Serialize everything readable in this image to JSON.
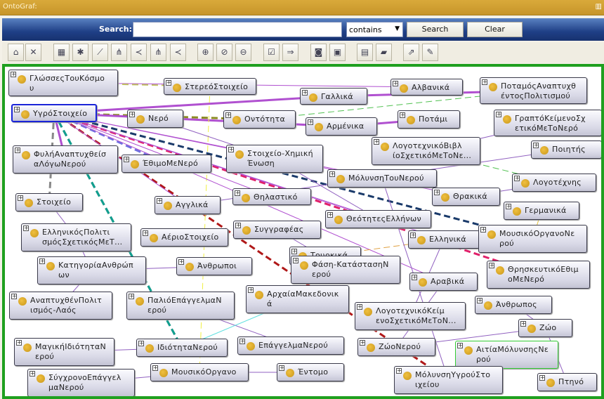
{
  "window": {
    "title": "OntoGraf:"
  },
  "search": {
    "label": "Search:",
    "value": "",
    "placeholder": "",
    "match_mode": "contains",
    "search_button": "Search",
    "clear_button": "Clear"
  },
  "toolbar": {
    "icons": [
      "home-icon",
      "remove-icon",
      "grid-layout-icon",
      "spring-layout-icon",
      "radial-layout-icon",
      "tree-vertical-icon",
      "tree-horizontal-icon",
      "tree-vertical-alt-icon",
      "tree-horizontal-alt-icon",
      "zoom-in-icon",
      "zoom-reset-icon",
      "zoom-out-icon",
      "filter-nodes-icon",
      "filter-arcs-icon",
      "snapshot-icon",
      "export-image-icon",
      "save-icon",
      "open-icon",
      "export-icon",
      "edit-icon"
    ]
  },
  "colors": {
    "accent": "#1fa01f",
    "selected": "#1a24d8",
    "title_bar": "#c7952a"
  },
  "nodes": [
    "ΓλώσσεςΤουΚόσμο\nυ",
    "ΣτερεόΣτοιχείο",
    "Γαλλικά",
    "Αλβανικά",
    "ΠοταμόςΑναπτυχθ\nέντοςΠολιτισμού",
    "ΥγρόΣτοιχείο",
    "Νερό",
    "Οντότητα",
    "Αρμένικα",
    "Ποτάμι",
    "ΓραπτόΚείμενοΣχ\nετικόΜεΤοΝερό",
    "ΛογοτεχνικόΒιβλ\nίοΣχετικόΜεΤοΝε...",
    "ΦυλήΑναπτυχθείσ\nαΛόγωΝερού",
    "ΈθιμοΜεΝερό",
    "Στοιχείο-Χημική\nΈνωση",
    "Ποιητής",
    "ΜόλυνσηΤουΝερού",
    "Λογοτέχνης",
    "Θηλαστικό",
    "Αγγλικά",
    "Στοιχείο",
    "Θρακικά",
    "Γερμανικά",
    "ΘεότητεςΕλλήνων",
    "ΕλληνικόςΠολιτι\nσμόςΣχετικόςΜεΤ...",
    "ΑέριοΣτοιχείο",
    "Συγγραφέας",
    "Ελληνικά",
    "ΜουσικόΟργανοΝε\nρού",
    "Τουρκικά",
    "Φάση-ΚατάστασηΝ\nερού",
    "ΚατηγορίαΑνθρώπ\nων",
    "Άνθρωποι",
    "ΘρησκευτικόΕθιμ\nοΜεΝερό",
    "Αραβικά",
    "ΑρχαίαΜακεδονικ\nά",
    "ΑναπτυχθένΠολιτ\nισμός-Λαός",
    "ΠαλιόΕπάγγελμαΝ\nερού",
    "Άνθρωπος",
    "ΛογοτεχνικόΚείμ\nενοΣχετικόΜεΤοΝ...",
    "Ζώο",
    "ΜαγικήΙδιότηταΝ\nερού",
    "ΙδιότηταΝερού",
    "ΕπάγγελμαΝερού",
    "ΖώοΝερού",
    "ΑιτίαΜόλυνσηςΝε\nρού",
    "ΜουσικόΟργανο",
    "Έντομο",
    "ΣύγχρονοΕπάγγελ\nμαΝερού",
    "ΜόλυνσηΥγρούΣτο\nιχείου",
    "Πτηνό"
  ],
  "selected_node": 5,
  "highlighted_node": 45,
  "edges": [
    [
      5,
      28,
      "#1a3a6a",
      "dash",
      3
    ],
    [
      5,
      49,
      "#b01818",
      "dash",
      3
    ],
    [
      5,
      33,
      "#e0206a",
      "dash",
      3
    ],
    [
      5,
      42,
      "#333333",
      "dash",
      3
    ],
    [
      5,
      42,
      "#10a090",
      "dash",
      3
    ],
    [
      5,
      7,
      "#8a8a20",
      "dash",
      3
    ],
    [
      5,
      20,
      "#888888",
      "dash",
      3
    ],
    [
      5,
      2,
      "#b050d0",
      "solid",
      3
    ],
    [
      5,
      8,
      "#b050d0",
      "solid",
      3
    ],
    [
      2,
      4,
      "#b050d0",
      "solid",
      3
    ],
    [
      8,
      9,
      "#b050d0",
      "solid",
      3
    ],
    [
      0,
      3,
      "#b050d0",
      "solid",
      1
    ],
    [
      5,
      12,
      "#b050d0",
      "solid",
      3
    ],
    [
      5,
      13,
      "#7070e0",
      "dash",
      3
    ],
    [
      7,
      4,
      "#50c050",
      "dash",
      1
    ],
    [
      1,
      46,
      "#f0f040",
      "dash",
      1
    ],
    [
      0,
      1,
      "#c0c060",
      "dash",
      2
    ],
    [
      5,
      16,
      "#b050d0",
      "solid",
      1
    ],
    [
      5,
      18,
      "#b050d0",
      "solid",
      1
    ],
    [
      5,
      19,
      "#b050d0",
      "solid",
      1
    ],
    [
      5,
      23,
      "#b050d0",
      "solid",
      1
    ],
    [
      5,
      27,
      "#b050d0",
      "solid",
      1
    ],
    [
      5,
      34,
      "#b050d0",
      "solid",
      1
    ],
    [
      5,
      21,
      "#b050d0",
      "solid",
      1
    ],
    [
      32,
      31,
      "#9060c0",
      "solid",
      1
    ],
    [
      42,
      41,
      "#9060c0",
      "solid",
      1
    ],
    [
      37,
      43,
      "#9060c0",
      "solid",
      1
    ],
    [
      46,
      48,
      "#9060c0",
      "solid",
      1
    ],
    [
      46,
      47,
      "#9060c0",
      "solid",
      1
    ],
    [
      44,
      40,
      "#9060c0",
      "solid",
      1
    ],
    [
      40,
      50,
      "#9060c0",
      "solid",
      1
    ],
    [
      38,
      40,
      "#9060c0",
      "solid",
      1
    ],
    [
      11,
      17,
      "#50c050",
      "dash",
      1
    ],
    [
      15,
      19,
      "#9060c0",
      "solid",
      1
    ],
    [
      17,
      21,
      "#9060c0",
      "solid",
      1
    ],
    [
      10,
      11,
      "#9060c0",
      "solid",
      1
    ],
    [
      42,
      35,
      "#60e0e0",
      "solid",
      1
    ],
    [
      29,
      27,
      "#e0a040",
      "dash",
      1
    ],
    [
      26,
      30,
      "#9060c0",
      "solid",
      1
    ],
    [
      16,
      49,
      "#9060c0",
      "solid",
      1
    ],
    [
      22,
      28,
      "#e0c040",
      "dash",
      1
    ],
    [
      27,
      39,
      "#9060c0",
      "solid",
      1
    ],
    [
      34,
      44,
      "#9060c0",
      "solid",
      1
    ],
    [
      24,
      31,
      "#9060c0",
      "solid",
      1
    ],
    [
      31,
      36,
      "#9060c0",
      "solid",
      1
    ],
    [
      20,
      24,
      "#9060c0",
      "solid",
      1
    ],
    [
      6,
      14,
      "#9060c0",
      "solid",
      1
    ],
    [
      14,
      23,
      "#9060c0",
      "solid",
      1
    ]
  ]
}
